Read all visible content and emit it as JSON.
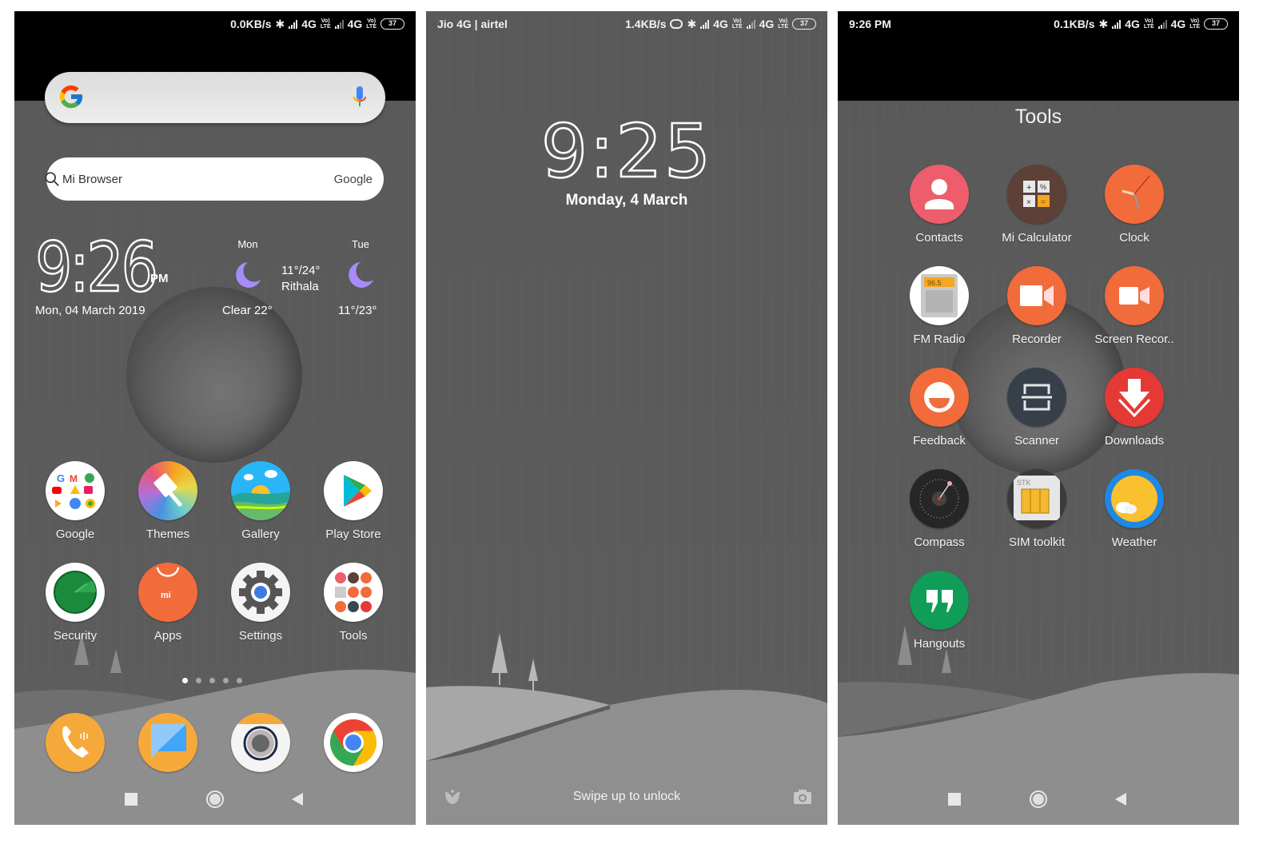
{
  "home": {
    "status": {
      "left": "",
      "speed": "0.0KB/s",
      "network1": "4G",
      "network2": "4G",
      "volte": "Vo) LTE",
      "battery": "37"
    },
    "search": {
      "mic_icon": "mic-icon",
      "logo": "google-g-icon"
    },
    "browser_bar": {
      "label": "Mi Browser",
      "engine": "Google"
    },
    "clock": {
      "time": "9:26",
      "ampm": "PM",
      "date": "Mon, 04 March 2019"
    },
    "weather": {
      "today": {
        "day": "Mon",
        "condition": "Clear 22°",
        "range": "11°/24°",
        "location": "Rithala"
      },
      "tomorrow": {
        "day": "Tue",
        "range": "11°/23°"
      }
    },
    "apps": [
      {
        "label": "Google"
      },
      {
        "label": "Themes"
      },
      {
        "label": "Gallery"
      },
      {
        "label": "Play Store"
      },
      {
        "label": "Security"
      },
      {
        "label": "Apps"
      },
      {
        "label": "Settings"
      },
      {
        "label": "Tools"
      }
    ],
    "pages": {
      "count": 5,
      "current": 1
    },
    "dock": [
      {
        "name": "phone",
        "icon": "phone-icon"
      },
      {
        "name": "messaging",
        "icon": "message-icon"
      },
      {
        "name": "camera",
        "icon": "camera-icon"
      },
      {
        "name": "chrome",
        "icon": "chrome-icon"
      }
    ]
  },
  "lock": {
    "status": {
      "carrier": "Jio 4G | airtel",
      "speed": "1.4KB/s",
      "network1": "4G",
      "network2": "4G",
      "battery": "37"
    },
    "time": "9:25",
    "date": "Monday, 4 March",
    "hint": "Swipe up to unlock"
  },
  "tools": {
    "status": {
      "time": "9:26 PM",
      "speed": "0.1KB/s",
      "network1": "4G",
      "network2": "4G",
      "battery": "37"
    },
    "folder_title": "Tools",
    "apps": [
      {
        "label": "Contacts"
      },
      {
        "label": "Mi Calculator"
      },
      {
        "label": "Clock"
      },
      {
        "label": "FM Radio",
        "display": "96.5"
      },
      {
        "label": "Recorder"
      },
      {
        "label": "Screen Recor.."
      },
      {
        "label": "Feedback"
      },
      {
        "label": "Scanner"
      },
      {
        "label": "Downloads"
      },
      {
        "label": "Compass"
      },
      {
        "label": "SIM toolkit",
        "chip_label": "STK"
      },
      {
        "label": "Weather"
      },
      {
        "label": "Hangouts"
      }
    ]
  },
  "colors": {
    "accent_orange": "#f26b3a",
    "contacts_pink": "#ee5d6c",
    "weather_moon": "#a78bfa",
    "hangouts_green": "#0f9d58",
    "dock_orange": "#f6a93b"
  }
}
